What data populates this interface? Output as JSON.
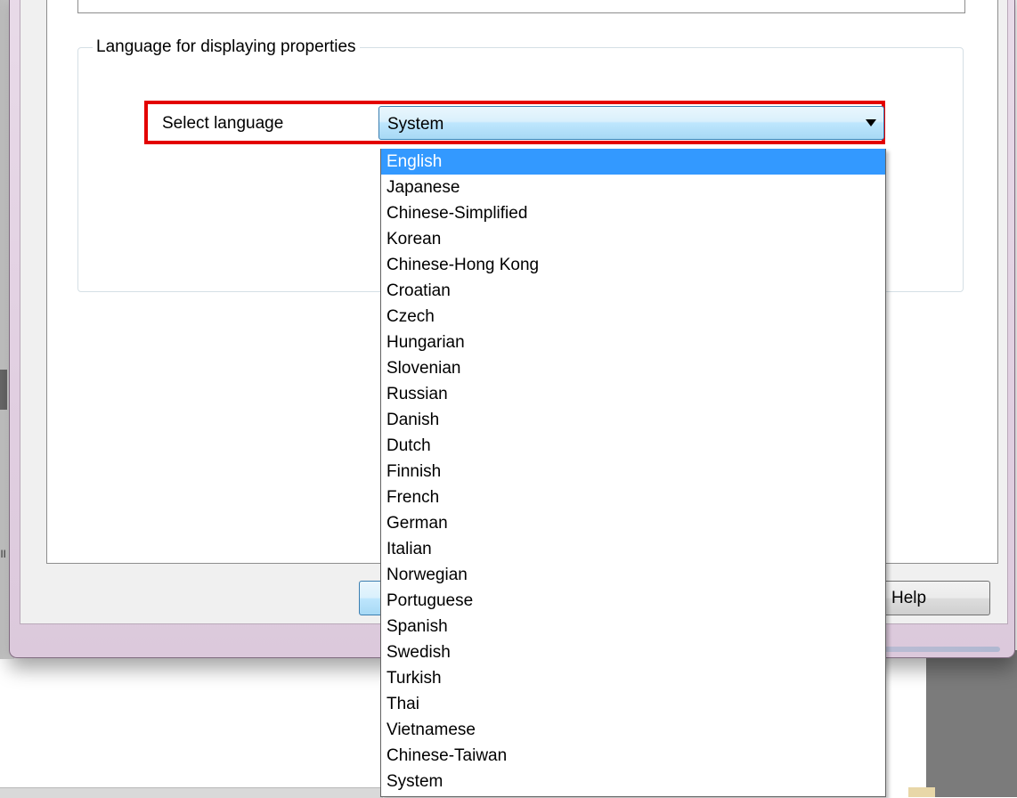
{
  "background": {
    "left_fragment_text": "ıı"
  },
  "group": {
    "legend": "Language for displaying properties",
    "select_label": "Select language"
  },
  "combo": {
    "value": "System",
    "arrow_icon": "dropdown-arrow-icon"
  },
  "dropdown": {
    "items": [
      {
        "label": "English",
        "selected": true
      },
      {
        "label": "Japanese"
      },
      {
        "label": "Chinese-Simplified"
      },
      {
        "label": "Korean"
      },
      {
        "label": "Chinese-Hong Kong"
      },
      {
        "label": "Croatian"
      },
      {
        "label": "Czech"
      },
      {
        "label": "Hungarian"
      },
      {
        "label": "Slovenian"
      },
      {
        "label": "Russian"
      },
      {
        "label": "Danish"
      },
      {
        "label": "Dutch"
      },
      {
        "label": "Finnish"
      },
      {
        "label": "French"
      },
      {
        "label": "German"
      },
      {
        "label": "Italian"
      },
      {
        "label": "Norwegian"
      },
      {
        "label": "Portuguese"
      },
      {
        "label": "Spanish"
      },
      {
        "label": "Swedish"
      },
      {
        "label": "Turkish"
      },
      {
        "label": "Thai"
      },
      {
        "label": "Vietnamese"
      },
      {
        "label": "Chinese-Taiwan"
      },
      {
        "label": "System"
      }
    ]
  },
  "buttons": {
    "help_label": "Help"
  },
  "colors": {
    "highlight": "#e30000",
    "selection": "#3399ff"
  }
}
